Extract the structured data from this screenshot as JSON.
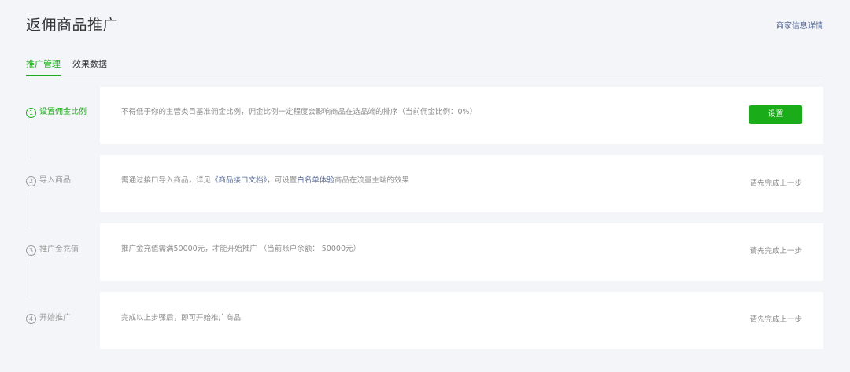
{
  "header": {
    "title": "返佣商品推广",
    "merchant_link": "商家信息详情"
  },
  "tabs": [
    {
      "label": "推广管理",
      "active": true
    },
    {
      "label": "效果数据",
      "active": false
    }
  ],
  "steps": [
    {
      "number": "1",
      "label": "设置佣金比例",
      "desc": "不得低于你的主营类目基准佣金比例，佣金比例一定程度会影响商品在选品端的排序（当前佣金比例：0%）",
      "action_label": "设置"
    },
    {
      "number": "2",
      "label": "导入商品",
      "desc_prefix": "需通过接口导入商品，详见",
      "desc_link1": "《商品接口文档》",
      "desc_middle": "，可设置",
      "desc_link2": "白名单体验",
      "desc_suffix": "商品在流量主端的效果",
      "status": "请先完成上一步"
    },
    {
      "number": "3",
      "label": "推广金充值",
      "desc": "推广金充值需满50000元，才能开始推广 （当前账户余额： 50000元）",
      "status": "请先完成上一步"
    },
    {
      "number": "4",
      "label": "开始推广",
      "desc": "完成以上步骤后，即可开始推广商品",
      "status": "请先完成上一步"
    }
  ],
  "colors": {
    "accent": "#1aad19",
    "link": "#576b95",
    "background": "#f4f5f9",
    "muted_text": "#8d8d8d"
  }
}
